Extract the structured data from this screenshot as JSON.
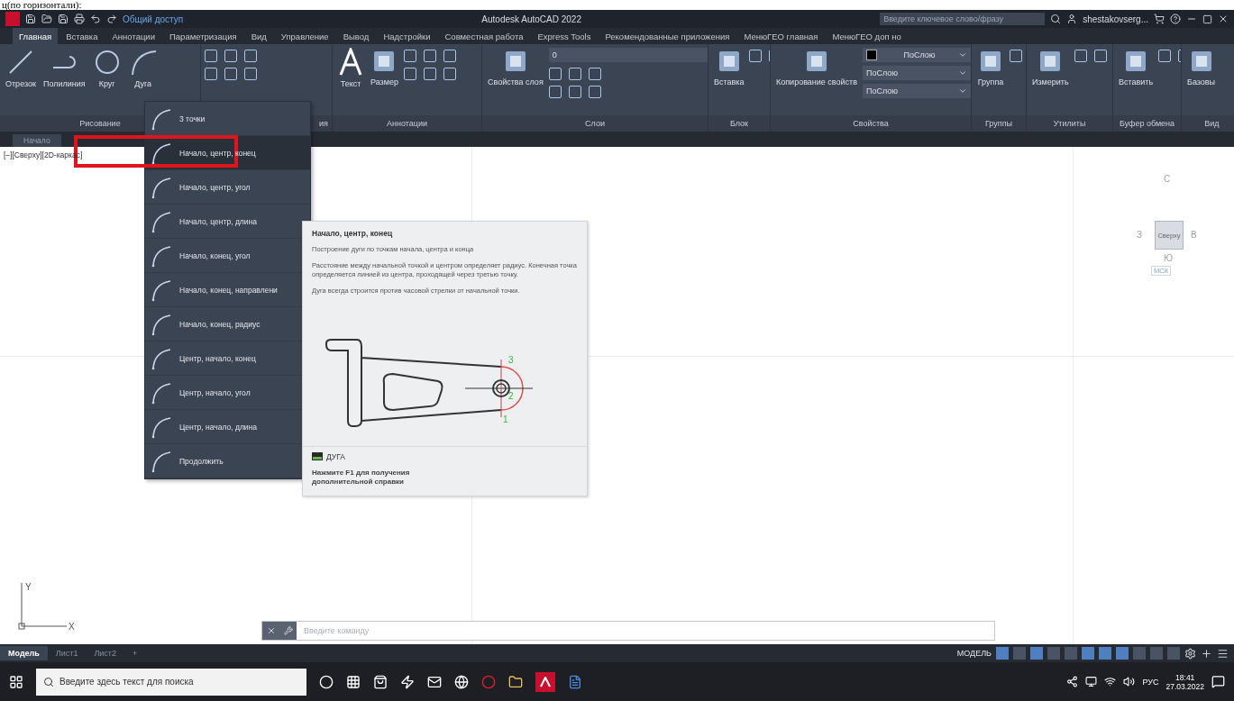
{
  "caption": "ц(по горизонтали):",
  "title_bar": {
    "share": "Общий доступ",
    "title": "Autodesk AutoCAD 2022",
    "search": {
      "placeholder": "Введите ключевое слово/фразу"
    },
    "user": "shestakovserg..."
  },
  "ribbon_tabs": [
    {
      "label": "Главная",
      "selected": true
    },
    {
      "label": "Вставка",
      "selected": false
    },
    {
      "label": "Аннотации",
      "selected": false
    },
    {
      "label": "Параметризация",
      "selected": false
    },
    {
      "label": "Вид",
      "selected": false
    },
    {
      "label": "Управление",
      "selected": false
    },
    {
      "label": "Вывод",
      "selected": false
    },
    {
      "label": "Надстройки",
      "selected": false
    },
    {
      "label": "Совместная работа",
      "selected": false
    },
    {
      "label": "Express Tools",
      "selected": false
    },
    {
      "label": "Рекомендованные приложения",
      "selected": false
    },
    {
      "label": "МенюГЕО главная",
      "selected": false
    },
    {
      "label": "МенюГЕО доп но",
      "selected": false
    }
  ],
  "ribbon_panels": [
    {
      "kind": "draw",
      "label": "Рисование",
      "tools": [
        "Отрезок",
        "Полилиния",
        "Круг",
        "Дуга"
      ]
    },
    {
      "kind": "edit",
      "label": "ия"
    },
    {
      "kind": "annot",
      "label": "Аннотации",
      "tools": [
        "Текст",
        "Размер"
      ]
    },
    {
      "kind": "layers",
      "label": "Слои",
      "tools": [
        "Свойства слоя"
      ],
      "layer": "0"
    },
    {
      "kind": "block",
      "label": "Блок",
      "tools": [
        "Вставка"
      ]
    },
    {
      "kind": "props",
      "label": "Свойства",
      "tools": [
        "Копирование свойств"
      ],
      "values": [
        "ПоСлою",
        "ПоСлою",
        "ПоСлою"
      ]
    },
    {
      "kind": "groups",
      "label": "Группы",
      "tools": [
        "Группа"
      ]
    },
    {
      "kind": "utils",
      "label": "Утилиты",
      "tools": [
        "Измерить"
      ]
    },
    {
      "kind": "clip",
      "label": "Буфер обмена",
      "tools": [
        "Вставить"
      ]
    },
    {
      "kind": "view",
      "label": "Вид",
      "tools": [
        "Базовы"
      ]
    }
  ],
  "file_tabs": [
    {
      "label": "Начало",
      "selected": false
    }
  ],
  "viewport_label": "[–][Сверху][2D-каркас]",
  "arc_menu": {
    "items": [
      {
        "label": "3 точки",
        "selected": false
      },
      {
        "label": "Начало, центр, конец",
        "selected": true
      },
      {
        "label": "Начало, центр, угол",
        "selected": false
      },
      {
        "label": "Начало, центр, длина",
        "selected": false
      },
      {
        "label": "Начало, конец, угол",
        "selected": false
      },
      {
        "label": "Начало, конец, направлени",
        "selected": false
      },
      {
        "label": "Начало, конец, радиус",
        "selected": false
      },
      {
        "label": "Центр, начало, конец",
        "selected": false
      },
      {
        "label": "Центр, начало, угол",
        "selected": false
      },
      {
        "label": "Центр, начало, длина",
        "selected": false
      },
      {
        "label": "Продолжить",
        "selected": false
      }
    ]
  },
  "tooltip": {
    "title": "Начало, центр, конец",
    "description": "Построение дуги по точкам начала, центра и конца",
    "details": [
      "Расстояние между начальной точкой и центром определяет радиус. Конечная точка определяется линией из центра, проходящей через третью точку.",
      "Дуга всегда строится против часовой стрелки от начальной точки."
    ],
    "point_labels": [
      "3",
      "2",
      "1"
    ],
    "command": "ДУГА",
    "help": "Нажмите F1 для получения дополнительной справки"
  },
  "view_cube": {
    "north": "С",
    "west": "З",
    "east": "В",
    "face": "Сверху",
    "south": "Ю",
    "ucs": "МСК"
  },
  "ucs_icon": {
    "y": "Y",
    "x": "X"
  },
  "command_line": {
    "placeholder": "Введите команду"
  },
  "layout_tabs": [
    {
      "label": "Модель",
      "selected": true
    },
    {
      "label": "Лист1",
      "selected": false
    },
    {
      "label": "Лист2",
      "selected": false
    },
    {
      "label": "+",
      "selected": false
    }
  ],
  "status_bar": {
    "mode": "МОДЕЛЬ"
  },
  "taskbar": {
    "search": {
      "placeholder": "Введите здесь текст для поиска"
    },
    "language": "РУС",
    "time": "18:41",
    "date": "27.03.2022"
  }
}
